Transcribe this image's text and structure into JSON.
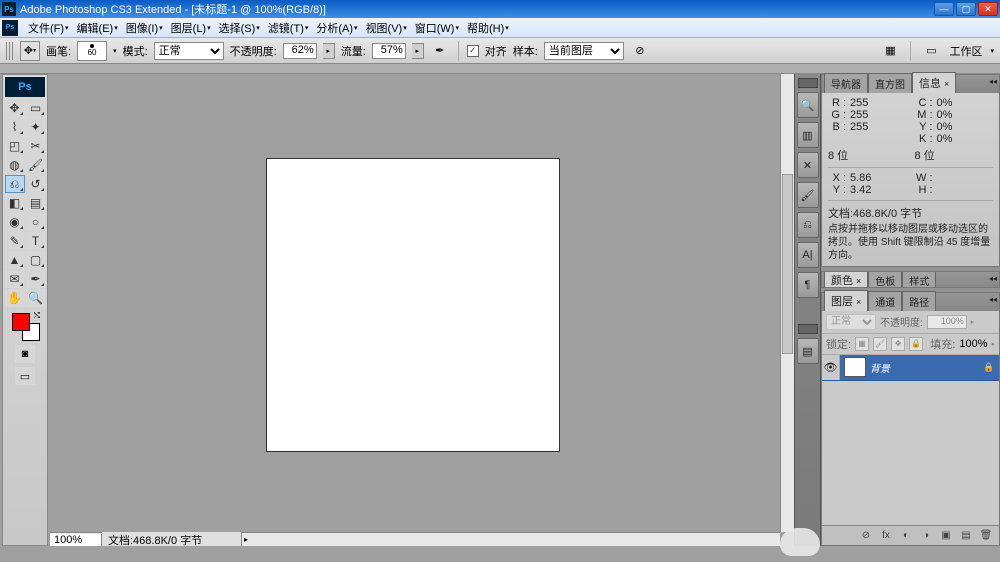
{
  "titlebar": {
    "app": "Adobe Photoshop CS3 Extended",
    "doc": "[未标题-1 @ 100%(RGB/8)]"
  },
  "menu": {
    "items": [
      "文件(F)",
      "编辑(E)",
      "图像(I)",
      "图层(L)",
      "选择(S)",
      "滤镜(T)",
      "分析(A)",
      "视图(V)",
      "窗口(W)",
      "帮助(H)"
    ]
  },
  "options": {
    "brush_label": "画笔:",
    "brush_size": "60",
    "mode_label": "模式:",
    "mode_value": "正常",
    "opacity_label": "不透明度:",
    "opacity_value": "62%",
    "flow_label": "流量:",
    "flow_value": "57%",
    "align_label": "对齐",
    "sample_label": "样本:",
    "sample_value": "当前图层",
    "workspace_label": "工作区"
  },
  "status": {
    "zoom": "100%",
    "doc": "文档:468.8K/0 字节"
  },
  "info_panel": {
    "tabs": [
      "导航器",
      "直方图",
      "信息"
    ],
    "r_label": "R :",
    "r": "255",
    "g_label": "G :",
    "g": "255",
    "b_label": "B :",
    "b": "255",
    "c_label": "C :",
    "c": "0%",
    "m_label": "M :",
    "m": "0%",
    "y_label": "Y :",
    "y": "0%",
    "k_label": "K :",
    "k": "0%",
    "bit_label": "8 位",
    "bit2": "8 位",
    "x_label": "X :",
    "x": "5.86",
    "yy_label": "Y :",
    "yy": "3.42",
    "w_label": "W :",
    "w": "",
    "h_label": "H :",
    "h": "",
    "doc": "文档:468.8K/0 字节",
    "hint": "点按并拖移以移动图层或移动选区的拷贝。使用 Shift 键限制沿 45 度增量方向。"
  },
  "color_panel": {
    "tabs": [
      "颜色",
      "色板",
      "样式"
    ]
  },
  "layers_panel": {
    "tabs": [
      "图层",
      "通道",
      "路径"
    ],
    "blend": "正常",
    "opacity_label": "不透明度:",
    "opacity": "100%",
    "lock_label": "锁定:",
    "fill_label": "填充:",
    "fill": "100%",
    "layer_name": "背景"
  }
}
